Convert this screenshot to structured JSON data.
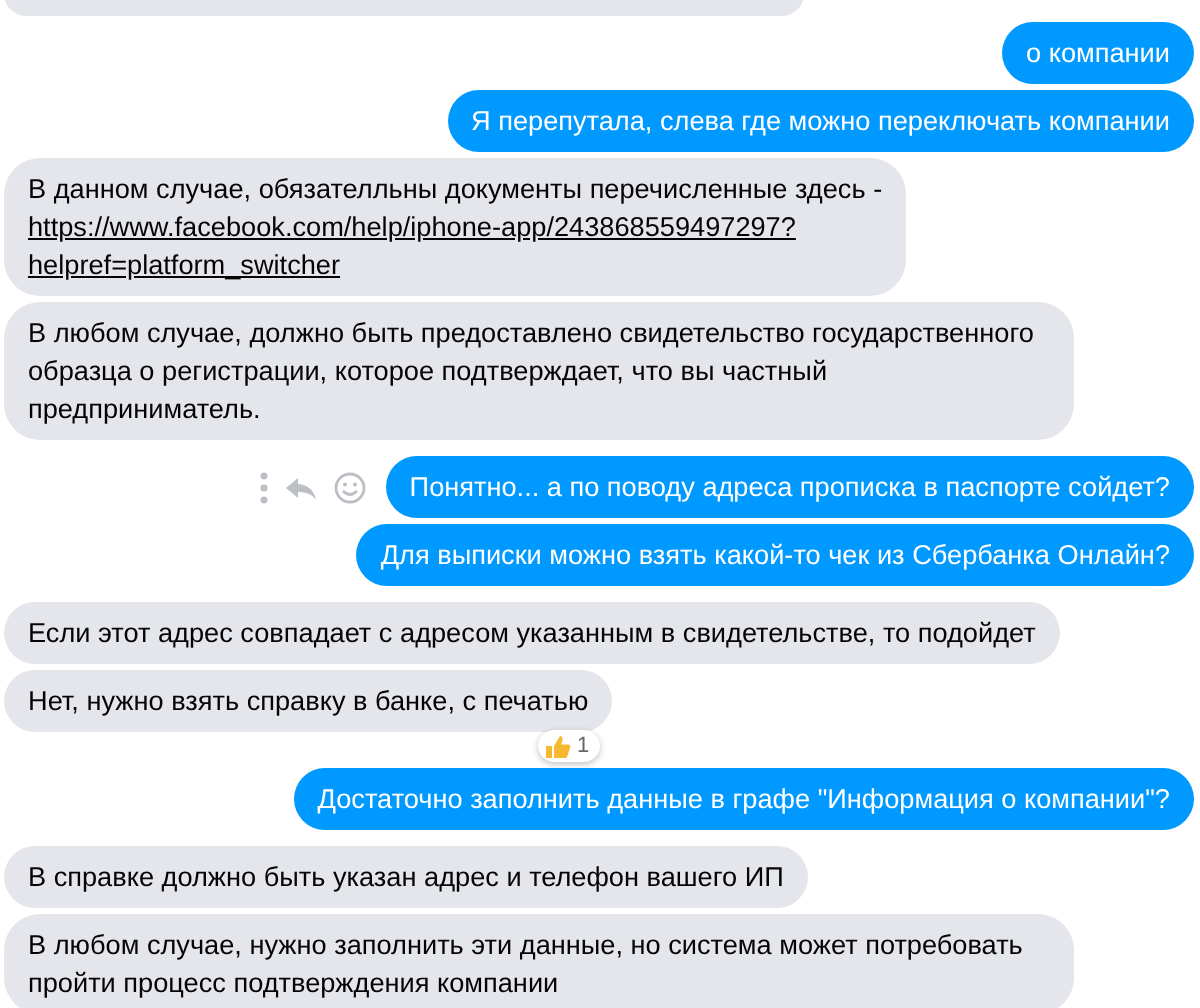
{
  "messages": [
    {
      "outgoing": false,
      "kind": "clipped"
    },
    {
      "outgoing": true,
      "kind": "text",
      "text": "о компании"
    },
    {
      "outgoing": true,
      "kind": "text",
      "text": "Я перепутала, слева где можно переключать компании"
    },
    {
      "outgoing": false,
      "kind": "parts",
      "parts": [
        {
          "kind": "text",
          "text": "В данном случае, обязателльны документы перечисленные здесь -"
        },
        {
          "kind": "link",
          "text": "https://www.facebook.com/help/iphone-app/243868559497297?"
        },
        {
          "kind": "link",
          "text": "helpref=platform_switcher"
        }
      ]
    },
    {
      "outgoing": false,
      "kind": "text",
      "text": "В любом случае, должно быть предоставлено свидетельство государственного образца о регистрации, которое подтверждает, что вы частный предприниматель.",
      "group_end": true
    },
    {
      "outgoing": true,
      "kind": "text",
      "text": "Понятно... а по поводу адреса прописка в паспорте сойдет?",
      "actions": true
    },
    {
      "outgoing": true,
      "kind": "text",
      "text": "Для выписки можно взять какой-то чек из Сбербанка Онлайн?",
      "group_end": true
    },
    {
      "outgoing": false,
      "kind": "text",
      "text": "Если этот адрес совпадает с адресом указанным в свидетельстве, то подойдет"
    },
    {
      "outgoing": false,
      "kind": "text",
      "text": "Нет, нужно взять справку в банке, с печатью",
      "reaction": {
        "count": "1"
      },
      "group_end": true
    },
    {
      "outgoing": true,
      "kind": "text",
      "text": "Достаточно заполнить данные в графе \"Информация о компании\"?",
      "group_end": true
    },
    {
      "outgoing": false,
      "kind": "text",
      "text": "В справке должно быть указан адрес и телефон вашего ИП"
    },
    {
      "outgoing": false,
      "kind": "text",
      "text": "В любом случае, нужно заполнить эти данные, но система может потребовать пройти процесс подтверждения компании"
    }
  ]
}
